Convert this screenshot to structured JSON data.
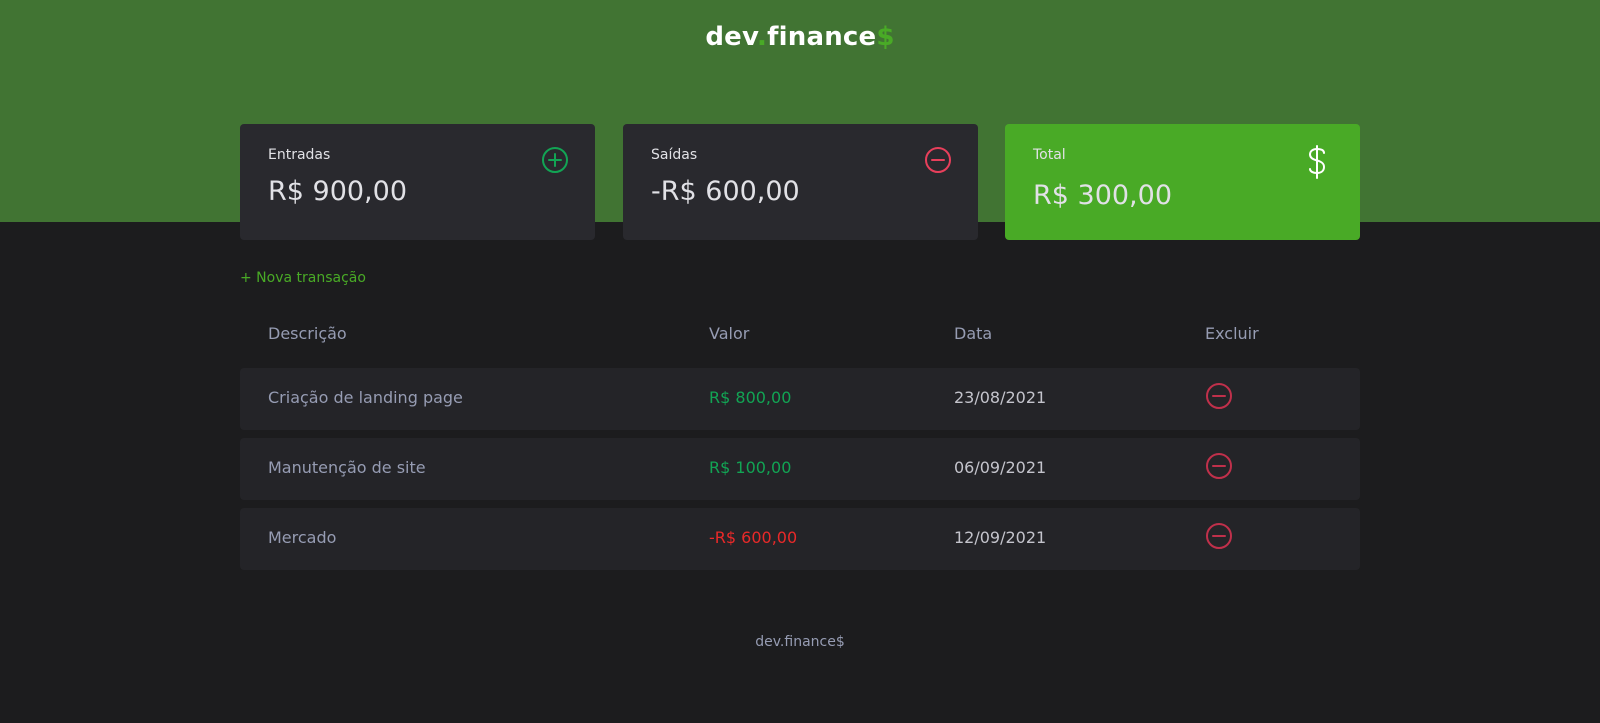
{
  "header": {
    "logo": {
      "prefix": "dev",
      "dot": ".",
      "main": "finance",
      "suffix": "$"
    }
  },
  "cards": {
    "income": {
      "label": "Entradas",
      "value": "R$ 900,00",
      "icon": "plus-circle-icon",
      "color": "#12a454"
    },
    "expense": {
      "label": "Saídas",
      "value": "-R$ 600,00",
      "icon": "minus-circle-icon",
      "color": "#e83f5b"
    },
    "total": {
      "label": "Total",
      "value": "R$ 300,00",
      "icon": "dollar-sign-icon",
      "color": "#49aa26"
    }
  },
  "new_transaction": {
    "label": "+ Nova transação"
  },
  "table": {
    "headers": {
      "description": "Descrição",
      "value": "Valor",
      "date": "Data",
      "delete": "Excluir"
    },
    "rows": [
      {
        "description": "Criação de landing page",
        "value": "R$ 800,00",
        "date": "23/08/2021",
        "type": "income"
      },
      {
        "description": "Manutenção de site",
        "value": "R$ 100,00",
        "date": "06/09/2021",
        "type": "income"
      },
      {
        "description": "Mercado",
        "value": "-R$ 600,00",
        "date": "12/09/2021",
        "type": "expense"
      }
    ]
  },
  "footer": {
    "text": "dev.finance$"
  },
  "colors": {
    "header_bg": "#417433",
    "page_bg": "#1c1c1e",
    "card_bg": "#29292e",
    "accent": "#49aa26",
    "income": "#12a454",
    "expense": "#e92929",
    "delete_icon": "#c0304b"
  }
}
